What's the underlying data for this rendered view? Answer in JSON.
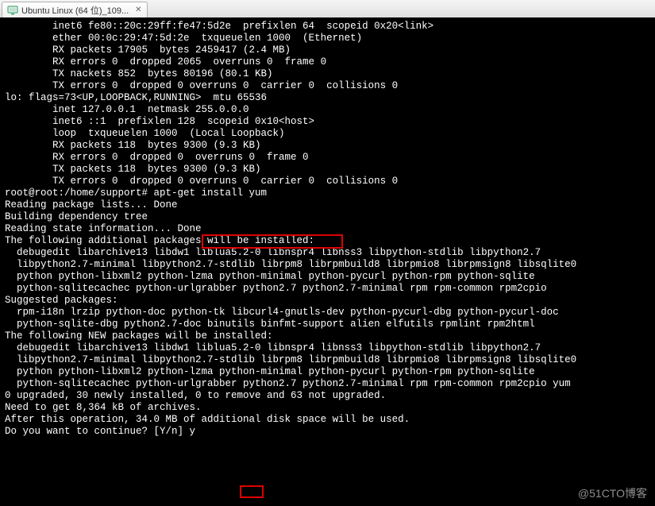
{
  "tab": {
    "title": "Ubuntu Linux (64 位)_109..."
  },
  "terminal": {
    "lines": [
      "        inet6 fe80::20c:29ff:fe47:5d2e  prefixlen 64  scopeid 0x20<link>",
      "        ether 00:0c:29:47:5d:2e  txqueuelen 1000  (Ethernet)",
      "        RX packets 17905  bytes 2459417 (2.4 MB)",
      "        RX errors 0  dropped 2065  overruns 0  frame 0",
      "        TX nackets 852  bytes 80196 (80.1 KB)",
      "        TX errors 0  dropped 0 overruns 0  carrier 0  collisions 0",
      "",
      "lo: flags=73<UP,LOOPBACK,RUNNING>  mtu 65536",
      "        inet 127.0.0.1  netmask 255.0.0.0",
      "        inet6 ::1  prefixlen 128  scopeid 0x10<host>",
      "        loop  txqueuelen 1000  (Local Loopback)",
      "        RX packets 118  bytes 9300 (9.3 KB)",
      "        RX errors 0  dropped 0  overruns 0  frame 0",
      "        TX packets 118  bytes 9300 (9.3 KB)",
      "        TX errors 0  dropped 0 overruns 0  carrier 0  collisions 0",
      "",
      "root@root:/home/support# apt-get install yum",
      "Reading package lists... Done",
      "Building dependency tree",
      "Reading state information... Done",
      "The following additional packages will be installed:",
      "  debugedit libarchive13 libdw1 liblua5.2-0 libnspr4 libnss3 libpython-stdlib libpython2.7",
      "  libpython2.7-minimal libpython2.7-stdlib librpm8 librpmbuild8 librpmio8 librpmsign8 libsqlite0",
      "  python python-libxml2 python-lzma python-minimal python-pycurl python-rpm python-sqlite",
      "  python-sqlitecachec python-urlgrabber python2.7 python2.7-minimal rpm rpm-common rpm2cpio",
      "Suggested packages:",
      "  rpm-i18n lrzip python-doc python-tk libcurl4-gnutls-dev python-pycurl-dbg python-pycurl-doc",
      "  python-sqlite-dbg python2.7-doc binutils binfmt-support alien elfutils rpmlint rpm2html",
      "The following NEW packages will be installed:",
      "  debugedit libarchive13 libdw1 liblua5.2-0 libnspr4 libnss3 libpython-stdlib libpython2.7",
      "  libpython2.7-minimal libpython2.7-stdlib librpm8 librpmbuild8 librpmio8 librpmsign8 libsqlite0",
      "  python python-libxml2 python-lzma python-minimal python-pycurl python-rpm python-sqlite",
      "  python-sqlitecachec python-urlgrabber python2.7 python2.7-minimal rpm rpm-common rpm2cpio yum",
      "0 upgraded, 30 newly installed, 0 to remove and 63 not upgraded.",
      "Need to get 8,364 kB of archives.",
      "After this operation, 34.0 MB of additional disk space will be used.",
      "Do you want to continue? [Y/n] y"
    ]
  },
  "watermark": "@51CTO博客"
}
